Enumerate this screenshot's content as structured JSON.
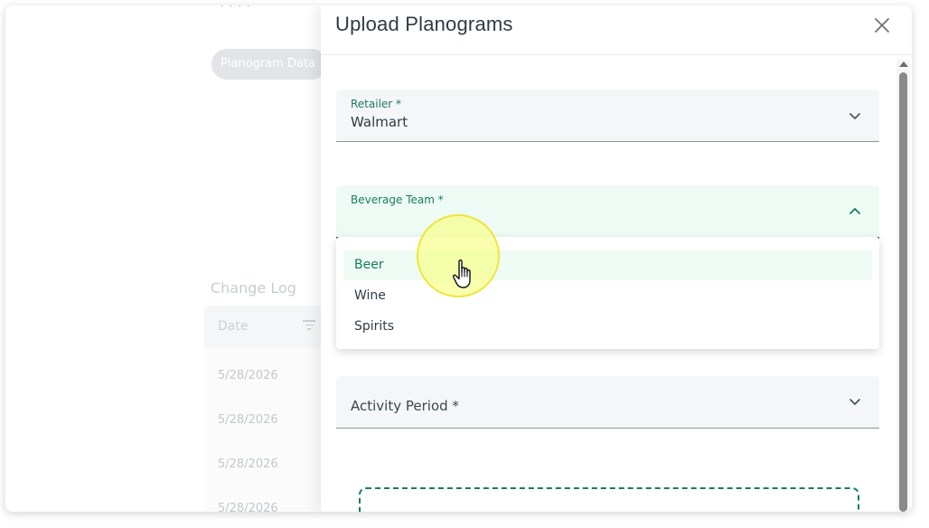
{
  "background_page": {
    "cut_text": "·  ·   ·  ·",
    "tab_pill": "Planogram Data",
    "change_log": {
      "title": "Change Log",
      "column_date": "Date",
      "rows": [
        "5/28/2026",
        "5/28/2026",
        "5/28/2026",
        "5/28/2026"
      ]
    }
  },
  "modal": {
    "title": "Upload Planograms",
    "close_icon": "close-icon",
    "retailer": {
      "label": "Retailer *",
      "value": "Walmart",
      "icon": "chevron-down-icon"
    },
    "beverage_team": {
      "label": "Beverage Team *",
      "value": "",
      "icon": "chevron-up-icon",
      "options": [
        "Beer",
        "Wine",
        "Spirits"
      ],
      "highlighted": "Beer"
    },
    "activity_period": {
      "label": "Activity Period *",
      "icon": "chevron-down-icon"
    }
  },
  "colors": {
    "accent": "#1a7a62",
    "focus_bg": "#eefbf4",
    "field_bg": "#f5f6f8",
    "text": "#2f3a45",
    "cursor_highlight": "#f7ff8c"
  }
}
